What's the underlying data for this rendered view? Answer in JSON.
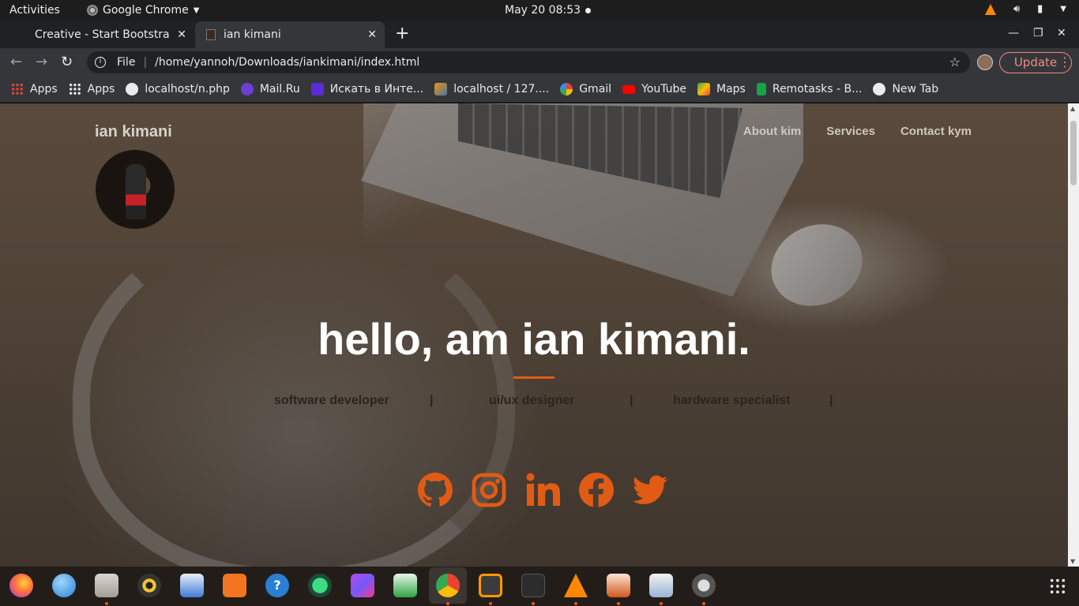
{
  "topbar": {
    "activities": "Activities",
    "app_name": "Google Chrome",
    "datetime": "May 20  08:53"
  },
  "tabs": [
    {
      "title": "Creative - Start Bootstrap",
      "active": false
    },
    {
      "title": "ian kimani",
      "active": true
    }
  ],
  "omnibox": {
    "scheme_label": "File",
    "url": "/home/yannoh/Downloads/iankimani/index.html"
  },
  "update_label": "Update",
  "bookmarks": [
    {
      "label": "Apps",
      "icon": "apps-grid-icon"
    },
    {
      "label": "Apps",
      "icon": "apps-grid-icon"
    },
    {
      "label": "localhost/n.php",
      "icon": "globe-icon"
    },
    {
      "label": "Mail.Ru",
      "icon": "mailru-icon"
    },
    {
      "label": "Искать в Инте...",
      "icon": "search-q-icon"
    },
    {
      "label": "localhost / 127....",
      "icon": "phpmyadmin-icon"
    },
    {
      "label": "Gmail",
      "icon": "google-icon"
    },
    {
      "label": "YouTube",
      "icon": "youtube-icon"
    },
    {
      "label": "Maps",
      "icon": "maps-icon"
    },
    {
      "label": "Remotasks - B...",
      "icon": "remotasks-icon"
    },
    {
      "label": "New Tab",
      "icon": "globe-icon"
    }
  ],
  "page": {
    "brand": "ian kimani",
    "nav": [
      "About kim",
      "Services",
      "Contact kym"
    ],
    "hero_title": "hello, am ian kimani.",
    "roles": [
      "software developer",
      "ui/ux designer",
      "hardware specialist"
    ],
    "role_separator": "|",
    "accent_color": "#e25b14",
    "socials": [
      "github-icon",
      "instagram-icon",
      "linkedin-icon",
      "facebook-icon",
      "twitter-icon"
    ]
  },
  "dock": [
    "firefox",
    "thunderbird",
    "files",
    "rhythmbox",
    "writer",
    "software-center",
    "help",
    "android-studio",
    "phpstorm",
    "calc",
    "chrome",
    "sublime-text",
    "terminal",
    "vlc",
    "impress",
    "reader",
    "updater"
  ]
}
